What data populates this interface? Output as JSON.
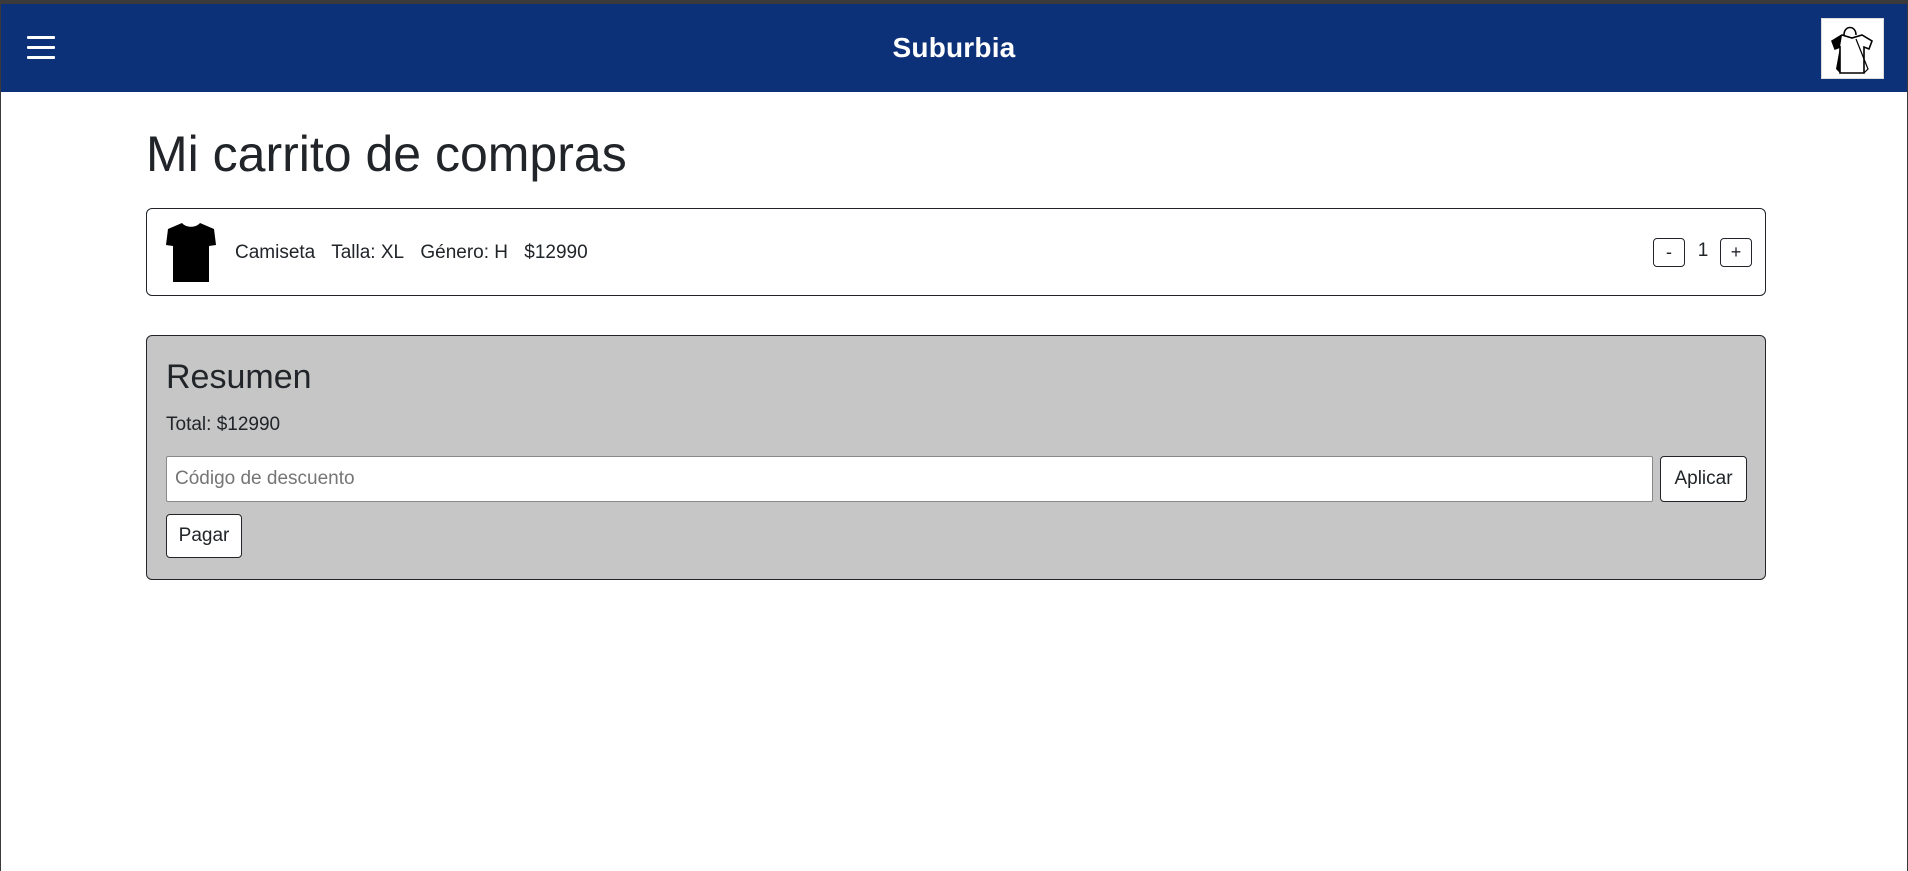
{
  "navbar": {
    "brand": "Suburbia",
    "menu_icon": "hamburger-menu-icon",
    "logo_icon": "shopping-bag-shirt-logo",
    "background_color": "#0d3178"
  },
  "page": {
    "title": "Mi carrito de compras"
  },
  "cart": {
    "items": [
      {
        "icon": "t-shirt-icon",
        "name": "Camiseta",
        "size": "Talla: XL",
        "gender": "Género: H",
        "price": "$12990",
        "quantity": "1",
        "decrement_label": "-",
        "increment_label": "+"
      }
    ]
  },
  "summary": {
    "title": "Resumen",
    "total": "Total: $12990",
    "discount_placeholder": "Código de descuento",
    "discount_value": "",
    "apply_label": "Aplicar",
    "pay_label": "Pagar",
    "background_color": "#c6c6c6"
  }
}
